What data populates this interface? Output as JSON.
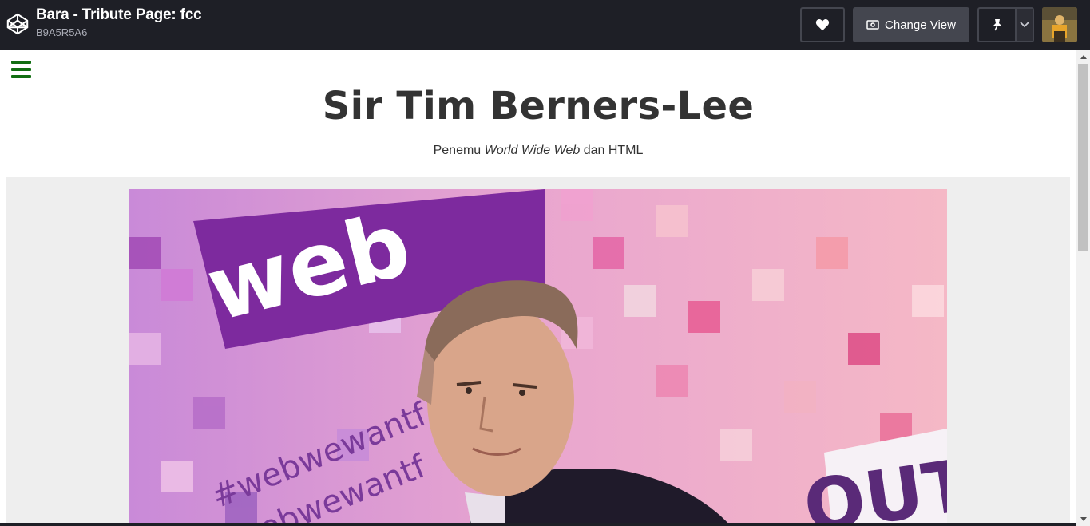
{
  "header": {
    "pen_title": "Bara - Tribute Page: fcc",
    "pen_user": "B9A5R5A6",
    "change_view_label": "Change View",
    "colors": {
      "bar": "#1e1f26",
      "button": "#44464f"
    }
  },
  "page": {
    "title": "Sir Tim Berners-Lee",
    "subtitle_prefix": "Penemu ",
    "subtitle_em": "World Wide Web",
    "subtitle_suffix": " dan HTML",
    "hamburger_color": "#126e12",
    "image_alt": "Tim Berners-Lee",
    "image_text_large": "web",
    "image_text_tag": "#webwewantf",
    "image_text_tag2": "ebwewantf",
    "image_text_side": "OUTH"
  }
}
